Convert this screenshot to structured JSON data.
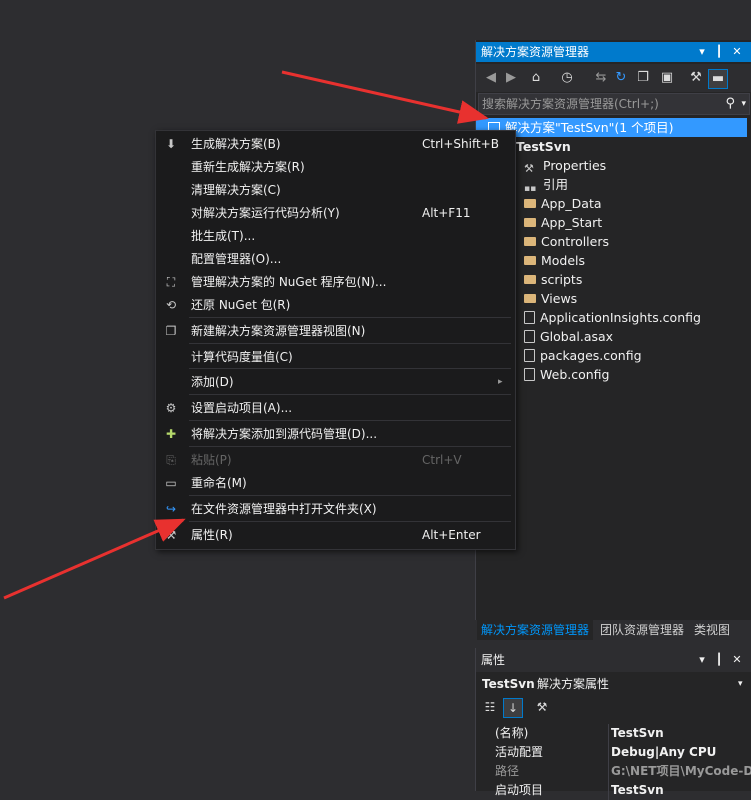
{
  "solution_explorer": {
    "title": "解决方案资源管理器",
    "title_buttons": [
      "▾",
      "✦",
      "✕"
    ],
    "search_placeholder": "搜索解决方案资源管理器(Ctrl+;)",
    "solution_node": "解决方案\"TestSvn\"(1 个项目)",
    "project_node": "TestSvn",
    "items": [
      {
        "label": "Properties",
        "icon": "wrench-icon"
      },
      {
        "label": "引用",
        "icon": "references-icon"
      },
      {
        "label": "App_Data",
        "icon": "folder-icon"
      },
      {
        "label": "App_Start",
        "icon": "folder-icon"
      },
      {
        "label": "Controllers",
        "icon": "folder-icon"
      },
      {
        "label": "Models",
        "icon": "folder-icon"
      },
      {
        "label": "scripts",
        "icon": "folder-icon"
      },
      {
        "label": "Views",
        "icon": "folder-icon"
      },
      {
        "label": "ApplicationInsights.config",
        "icon": "config-file-icon"
      },
      {
        "label": "Global.asax",
        "icon": "asax-file-icon"
      },
      {
        "label": "packages.config",
        "icon": "config-file-icon"
      },
      {
        "label": "Web.config",
        "icon": "config-file-icon"
      }
    ]
  },
  "bottom_tabs": [
    "解决方案资源管理器",
    "团队资源管理器",
    "类视图"
  ],
  "properties": {
    "title": "属性",
    "object_name": "TestSvn",
    "object_type": "解决方案属性",
    "rows": [
      {
        "key": "(名称)",
        "value": "TestSvn"
      },
      {
        "key": "活动配置",
        "value": "Debug|Any CPU"
      },
      {
        "key": "路径",
        "value": "G:\\NET项目\\MyCode-D"
      },
      {
        "key": "启动项目",
        "value": "TestSvn"
      }
    ]
  },
  "context_menu": {
    "items": [
      {
        "label": "生成解决方案(B)",
        "shortcut": "Ctrl+Shift+B",
        "icon": "build-icon"
      },
      {
        "label": "重新生成解决方案(R)",
        "shortcut": "",
        "icon": ""
      },
      {
        "label": "清理解决方案(C)",
        "shortcut": "",
        "icon": ""
      },
      {
        "label": "对解决方案运行代码分析(Y)",
        "shortcut": "Alt+F11",
        "icon": ""
      },
      {
        "label": "批生成(T)...",
        "shortcut": "",
        "icon": ""
      },
      {
        "label": "配置管理器(O)...",
        "shortcut": "",
        "icon": ""
      },
      {
        "label": "管理解决方案的 NuGet 程序包(N)...",
        "shortcut": "",
        "icon": "nuget-icon"
      },
      {
        "label": "还原 NuGet 包(R)",
        "shortcut": "",
        "icon": "restore-icon"
      },
      {
        "label": "新建解决方案资源管理器视图(N)",
        "shortcut": "",
        "icon": "new-view-icon"
      },
      {
        "label": "计算代码度量值(C)",
        "shortcut": "",
        "icon": ""
      },
      {
        "label": "添加(D)",
        "shortcut": "",
        "icon": ""
      },
      {
        "label": "设置启动项目(A)...",
        "shortcut": "",
        "icon": "gear-icon"
      },
      {
        "label": "将解决方案添加到源代码管理(D)...",
        "shortcut": "",
        "icon": "source-control-icon"
      },
      {
        "label": "粘贴(P)",
        "shortcut": "Ctrl+V",
        "icon": "paste-icon"
      },
      {
        "label": "重命名(M)",
        "shortcut": "",
        "icon": "rename-icon"
      },
      {
        "label": "在文件资源管理器中打开文件夹(X)",
        "shortcut": "",
        "icon": "open-folder-icon"
      },
      {
        "label": "属性(R)",
        "shortcut": "Alt+Enter",
        "icon": "wrench-icon"
      }
    ]
  },
  "colors": {
    "accent": "#007acc",
    "selection": "#3399ff",
    "annotation_arrow": "#e8312f"
  }
}
